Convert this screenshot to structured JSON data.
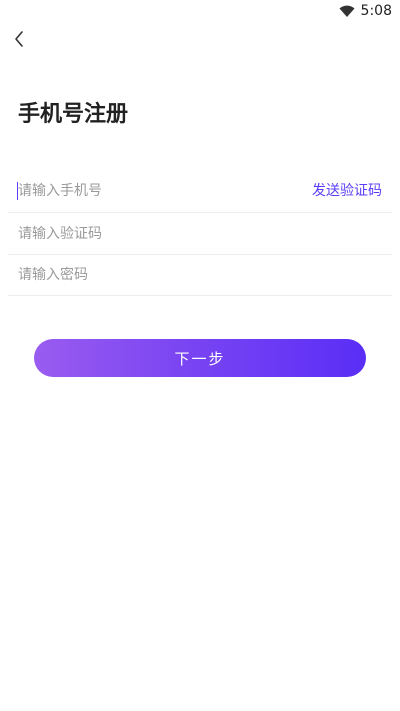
{
  "status_bar": {
    "time": "5:08",
    "wifi_icon": "wifi-icon"
  },
  "nav": {
    "back_icon": "chevron-left-icon"
  },
  "page": {
    "title": "手机号注册"
  },
  "form": {
    "phone": {
      "placeholder": "请输入手机号",
      "value": ""
    },
    "send_code_label": "发送验证码",
    "code": {
      "placeholder": "请输入验证码",
      "value": ""
    },
    "password": {
      "placeholder": "请输入密码",
      "value": ""
    }
  },
  "actions": {
    "next_label": "下一步"
  },
  "colors": {
    "accent": "#5b3df5",
    "button_gradient_start": "#9a5cf0",
    "button_gradient_end": "#5a2ef6"
  }
}
